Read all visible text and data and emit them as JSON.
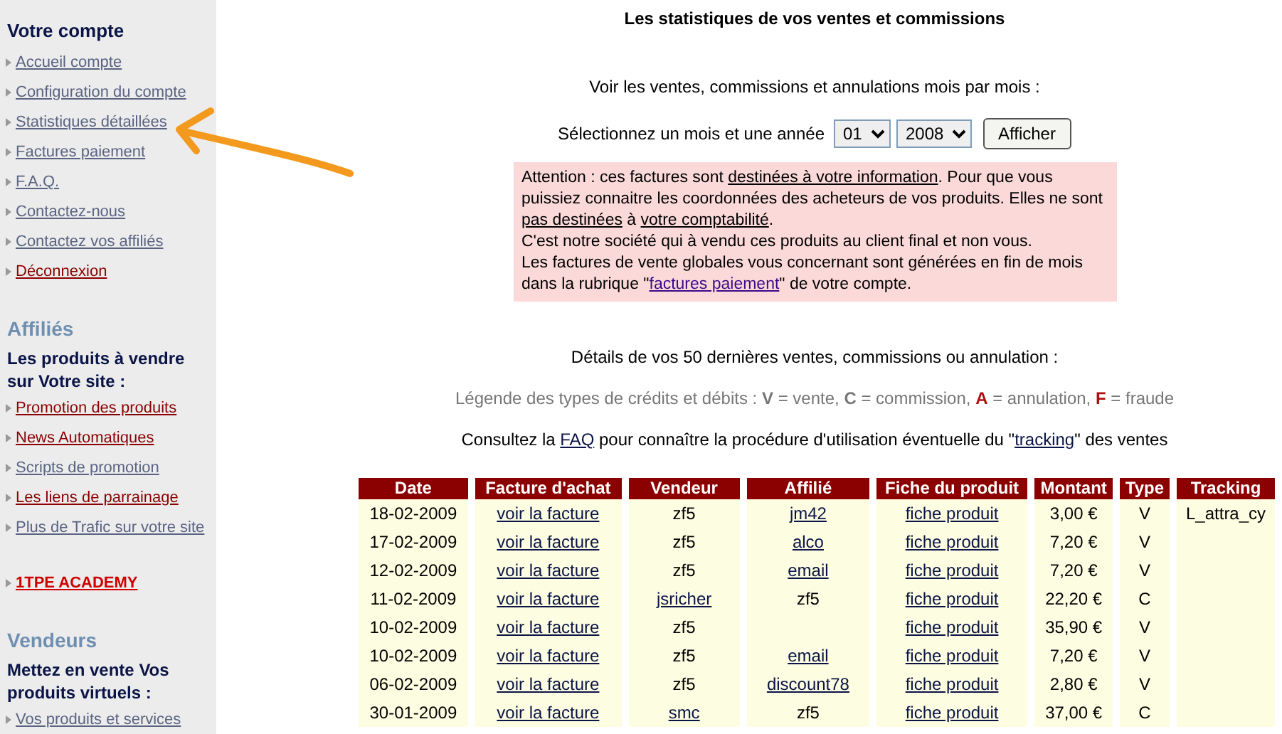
{
  "sidebar": {
    "sections": [
      {
        "heading": "Votre compte",
        "kind": "account",
        "items": [
          {
            "label": "Accueil compte",
            "color": "#5a6482"
          },
          {
            "label": "Configuration du compte",
            "color": "#5a6482"
          },
          {
            "label": "Statistiques détaillées",
            "color": "#5a6482"
          },
          {
            "label": "Factures paiement",
            "color": "#5a6482"
          },
          {
            "label": "F.A.Q.",
            "color": "#5a6482"
          },
          {
            "label": "Contactez-nous",
            "color": "#5a6482"
          },
          {
            "label": "Contactez vos affiliés",
            "color": "#5a6482"
          },
          {
            "label": "Déconnexion",
            "color": "#8b0000"
          }
        ]
      },
      {
        "heading": "Affiliés",
        "subheading": "Les produits à vendre sur Votre site :",
        "kind": "group",
        "items": [
          {
            "label": "Promotion des produits",
            "color": "#8b0000"
          },
          {
            "label": "News Automatiques",
            "color": "#8b0000"
          },
          {
            "label": "Scripts de promotion",
            "color": "#5a6482"
          },
          {
            "label": "Les liens de parrainage",
            "color": "#8b0000"
          },
          {
            "label": "Plus de Trafic sur votre site",
            "color": "#5a6482"
          }
        ]
      },
      {
        "kind": "promo",
        "items": [
          {
            "label": "1TPE ACADEMY",
            "color": "#d00000"
          }
        ]
      },
      {
        "heading": "Vendeurs",
        "subheading": "Mettez en vente Vos produits virtuels :",
        "kind": "group",
        "items": [
          {
            "label": "Vos produits et services",
            "color": "#5a6482"
          }
        ]
      }
    ]
  },
  "page_title": "Les statistiques de vos ventes et commissions",
  "intro": "Voir les ventes, commissions et annulations mois par mois :",
  "filter": {
    "label": "Sélectionnez un mois et une année",
    "month": "01",
    "year": "2008",
    "button": "Afficher"
  },
  "notice": [
    [
      {
        "kind": "plain",
        "text": "Attention : ces factures sont "
      },
      {
        "kind": "underline",
        "text": "destinées à votre information"
      },
      {
        "kind": "plain",
        "text": ". Pour que vous puissiez connaitre les coordonnées des acheteurs de vos produits. Elles ne sont "
      },
      {
        "kind": "underline",
        "text": "pas destinées"
      },
      {
        "kind": "plain",
        "text": " à "
      },
      {
        "kind": "underline",
        "text": "votre comptabilité"
      },
      {
        "kind": "plain",
        "text": "."
      }
    ],
    [
      {
        "kind": "plain",
        "text": "C'est notre société qui à vendu ces produits au client final et non vous."
      }
    ],
    [
      {
        "kind": "plain",
        "text": "Les factures de vente globales vous concernant sont générées en fin de mois dans la rubrique \""
      },
      {
        "kind": "link",
        "text": "factures paiement"
      },
      {
        "kind": "plain",
        "text": "\" de votre compte."
      }
    ]
  ],
  "details_heading": "Détails de vos 50 dernières ventes, commissions ou annulation :",
  "legend": [
    {
      "kind": "plain",
      "text": "Légende des types de crédits et débits : "
    },
    {
      "kind": "bold",
      "text": "V"
    },
    {
      "kind": "plain",
      "text": " = vente, "
    },
    {
      "kind": "bold",
      "text": "C"
    },
    {
      "kind": "plain",
      "text": " = commission, "
    },
    {
      "kind": "alert",
      "text": "A"
    },
    {
      "kind": "plain",
      "text": " = annulation, "
    },
    {
      "kind": "alert",
      "text": "F"
    },
    {
      "kind": "plain",
      "text": " = fraude"
    }
  ],
  "faq_line": [
    {
      "kind": "plain",
      "text": "Consultez la "
    },
    {
      "kind": "link",
      "text": "FAQ"
    },
    {
      "kind": "plain",
      "text": " pour connaître la procédure d'utilisation éventuelle du \""
    },
    {
      "kind": "link",
      "text": "tracking"
    },
    {
      "kind": "plain",
      "text": "\" des ventes"
    }
  ],
  "table": {
    "columns": [
      "Date",
      "Facture d'achat",
      "Vendeur",
      "Affilié",
      "Fiche du produit",
      "Montant",
      "Type",
      "Tracking"
    ],
    "rows": [
      [
        {
          "text": "18-02-2009",
          "link": false
        },
        {
          "text": "voir la facture",
          "link": true
        },
        {
          "text": "zf5",
          "link": false
        },
        {
          "text": "jm42",
          "link": true
        },
        {
          "text": "fiche produit",
          "link": true
        },
        {
          "text": "3,00 €",
          "link": false
        },
        {
          "text": "V",
          "link": false
        },
        {
          "text": "L_attra_cy",
          "link": false
        }
      ],
      [
        {
          "text": "17-02-2009",
          "link": false
        },
        {
          "text": "voir la facture",
          "link": true
        },
        {
          "text": "zf5",
          "link": false
        },
        {
          "text": "alco",
          "link": true
        },
        {
          "text": "fiche produit",
          "link": true
        },
        {
          "text": "7,20 €",
          "link": false
        },
        {
          "text": "V",
          "link": false
        },
        {
          "link": false
        }
      ],
      [
        {
          "text": "12-02-2009",
          "link": false
        },
        {
          "text": "voir la facture",
          "link": true
        },
        {
          "text": "zf5",
          "link": false
        },
        {
          "text": "email",
          "link": true
        },
        {
          "text": "fiche produit",
          "link": true
        },
        {
          "text": "7,20 €",
          "link": false
        },
        {
          "text": "V",
          "link": false
        },
        {
          "link": false
        }
      ],
      [
        {
          "text": "11-02-2009",
          "link": false
        },
        {
          "text": "voir la facture",
          "link": true
        },
        {
          "text": "jsricher",
          "link": true
        },
        {
          "text": "zf5",
          "link": false
        },
        {
          "text": "fiche produit",
          "link": true
        },
        {
          "text": "22,20 €",
          "link": false
        },
        {
          "text": "C",
          "link": false
        },
        {
          "link": false
        }
      ],
      [
        {
          "text": "10-02-2009",
          "link": false
        },
        {
          "text": "voir la facture",
          "link": true
        },
        {
          "text": "zf5",
          "link": false
        },
        {
          "link": false
        },
        {
          "text": "fiche produit",
          "link": true
        },
        {
          "text": "35,90 €",
          "link": false
        },
        {
          "text": "V",
          "link": false
        },
        {
          "link": false
        }
      ],
      [
        {
          "text": "10-02-2009",
          "link": false
        },
        {
          "text": "voir la facture",
          "link": true
        },
        {
          "text": "zf5",
          "link": false
        },
        {
          "text": "email",
          "link": true
        },
        {
          "text": "fiche produit",
          "link": true
        },
        {
          "text": "7,20 €",
          "link": false
        },
        {
          "text": "V",
          "link": false
        },
        {
          "link": false
        }
      ],
      [
        {
          "text": "06-02-2009",
          "link": false
        },
        {
          "text": "voir la facture",
          "link": true
        },
        {
          "text": "zf5",
          "link": false
        },
        {
          "text": "discount78",
          "link": true
        },
        {
          "text": "fiche produit",
          "link": true
        },
        {
          "text": "2,80 €",
          "link": false
        },
        {
          "text": "V",
          "link": false
        },
        {
          "link": false
        }
      ],
      [
        {
          "text": "30-01-2009",
          "link": false
        },
        {
          "text": "voir la facture",
          "link": true
        },
        {
          "text": "smc",
          "link": true
        },
        {
          "text": "zf5",
          "link": false
        },
        {
          "text": "fiche produit",
          "link": true
        },
        {
          "text": "37,00 €",
          "link": false
        },
        {
          "text": "C",
          "link": false
        },
        {
          "link": false
        }
      ]
    ]
  }
}
